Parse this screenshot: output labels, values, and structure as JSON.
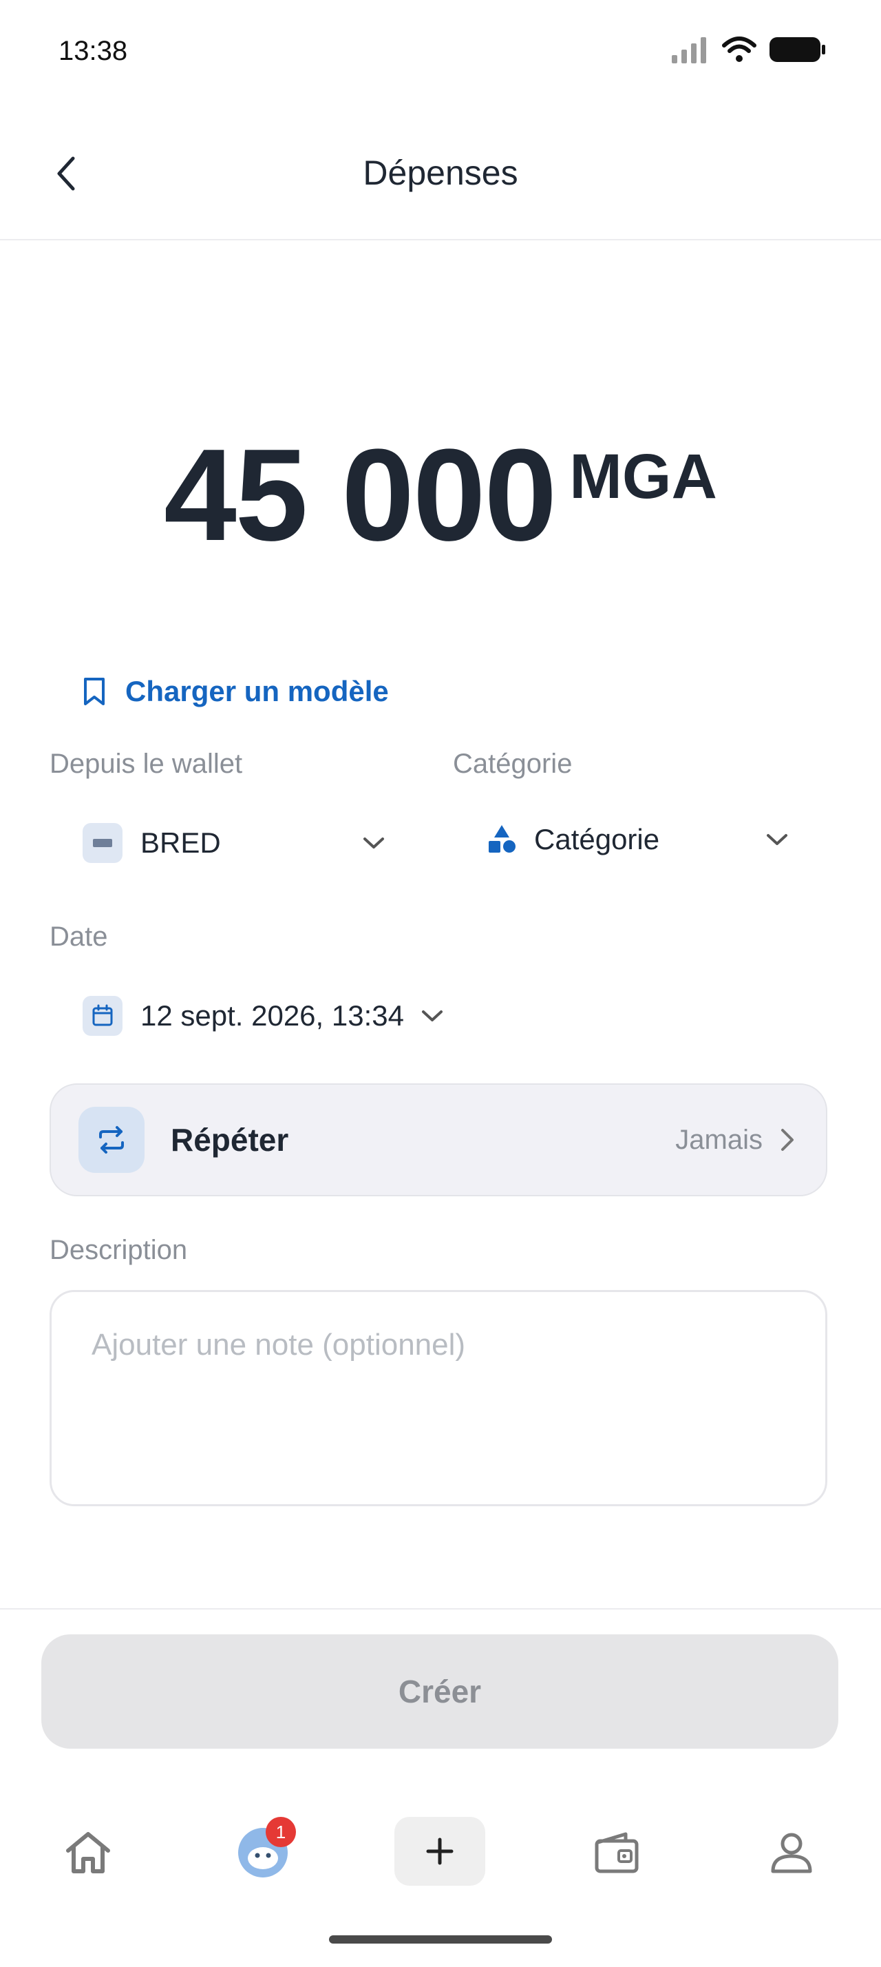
{
  "status_bar": {
    "time": "13:38"
  },
  "header": {
    "title": "Dépenses"
  },
  "amount": {
    "value": "45 000",
    "currency": "MGA"
  },
  "template_link": {
    "label": "Charger un modèle"
  },
  "wallet": {
    "label": "Depuis le wallet",
    "value": "BRED"
  },
  "category": {
    "label": "Catégorie",
    "value": "Catégorie"
  },
  "date": {
    "label": "Date",
    "value": "12 sept. 2026, 13:34"
  },
  "repeat": {
    "label": "Répéter",
    "value": "Jamais"
  },
  "description": {
    "label": "Description",
    "placeholder": "Ajouter une note (optionnel)"
  },
  "create_button": {
    "label": "Créer"
  },
  "bottom_nav": {
    "notification_badge": "1"
  },
  "colors": {
    "accent": "#1565c0",
    "text": "#1f2733",
    "muted": "#8a8f97",
    "badge": "#e53935"
  },
  "icons": {
    "back": "chevron-left-icon",
    "bookmark": "bookmark-icon",
    "category": "shapes-icon",
    "calendar": "calendar-icon",
    "repeat": "repeat-icon",
    "home": "home-icon",
    "mascot": "mascot-avatar-icon",
    "plus": "plus-icon",
    "wallet": "wallet-icon",
    "profile": "user-icon"
  }
}
